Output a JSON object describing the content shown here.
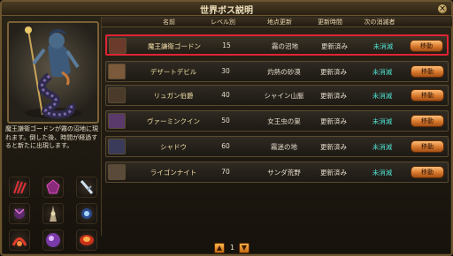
{
  "window": {
    "title": "世界ボス説明",
    "close_label": "×"
  },
  "description": "魔王謙衛ゴードンが霧の沼地に現れます。倒した後、時間が経過すると新たに出現します。",
  "table": {
    "headers": {
      "name": "名前",
      "level": "レベル別",
      "location": "地点更新",
      "update_time": "更新時間",
      "next_killer": "次の消滅者"
    },
    "rows": [
      {
        "name": "魔王謙衛ゴードン",
        "level": "15",
        "location": "霧の沼地",
        "update_time": "更新済み",
        "next_killer": "未消滅",
        "button": "移動",
        "selected": true,
        "icon_color": "#6b3a2a"
      },
      {
        "name": "デザートデビル",
        "level": "30",
        "location": "灼熱の砂漠",
        "update_time": "更新済み",
        "next_killer": "未消滅",
        "button": "移動",
        "selected": false,
        "icon_color": "#7a5a3a"
      },
      {
        "name": "リュガン伯爵",
        "level": "40",
        "location": "シャイン山脈",
        "update_time": "更新済み",
        "next_killer": "未消滅",
        "button": "移動",
        "selected": false,
        "icon_color": "#4a3a2a"
      },
      {
        "name": "ヴァーミンクイン",
        "level": "50",
        "location": "女王虫の巣",
        "update_time": "更新済み",
        "next_killer": "未消滅",
        "button": "移動",
        "selected": false,
        "icon_color": "#5a3a6a"
      },
      {
        "name": "シャドウ",
        "level": "60",
        "location": "霧迷の地",
        "update_time": "更新済み",
        "next_killer": "未消滅",
        "button": "移動",
        "selected": false,
        "icon_color": "#3a3a5a"
      },
      {
        "name": "ライゴンナイト",
        "level": "70",
        "location": "サンダ荒野",
        "update_time": "更新済み",
        "next_killer": "未消滅",
        "button": "移動",
        "selected": false,
        "icon_color": "#5a4a3a"
      }
    ]
  },
  "pagination": {
    "page": "1",
    "prev_label": "▲",
    "next_label": "▼"
  },
  "skill_icons": [
    "claw-skill-icon",
    "purple-gem-skill-icon",
    "sword-skill-icon",
    "dark-orb-skill-icon",
    "spire-skill-icon",
    "blue-orb-skill-icon",
    "red-burst-skill-icon",
    "violet-sphere-skill-icon",
    "fire-orb-skill-icon"
  ]
}
